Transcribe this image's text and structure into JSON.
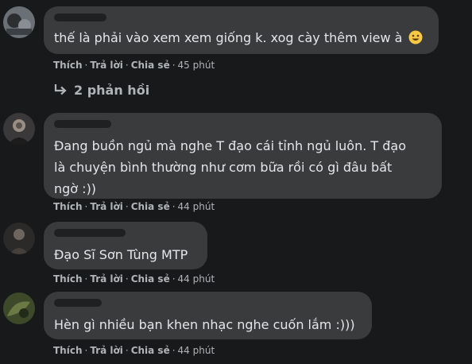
{
  "comments": [
    {
      "author": "",
      "text": "thế là phải vào xem xem giống k. xog cày thêm view à",
      "emoji": "smile-emoji",
      "actions": {
        "like": "Thích",
        "reply": "Trả lời",
        "share": "Chia sẻ",
        "time": "45 phút"
      },
      "replies_label": "2 phản hồi"
    },
    {
      "author": "",
      "text_lines": [
        "Đang buồn ngủ mà nghe T đạo cái tỉnh ngủ luôn. T đạo",
        "là chuyện bình thường như cơm bữa rồi có gì đâu bất",
        "ngờ :))"
      ],
      "actions": {
        "like": "Thích",
        "reply": "Trả lời",
        "share": "Chia sẻ",
        "time": "44 phút"
      }
    },
    {
      "author": "",
      "text": "Đạo Sĩ Sơn Tùng MTP",
      "actions": {
        "like": "Thích",
        "reply": "Trả lời",
        "share": "Chia sẻ",
        "time": "44 phút"
      }
    },
    {
      "author": "",
      "text": "Hèn gì nhiều bạn khen nhạc nghe cuốn lắm :)))",
      "actions": {
        "like": "Thích",
        "reply": "Trả lời",
        "share": "Chia sẻ",
        "time": "44 phút"
      }
    }
  ],
  "separator": "·",
  "colors": {
    "background": "#18191a",
    "bubble": "#3a3b3c",
    "text": "#e4e6eb",
    "muted": "#b0b3b8"
  }
}
